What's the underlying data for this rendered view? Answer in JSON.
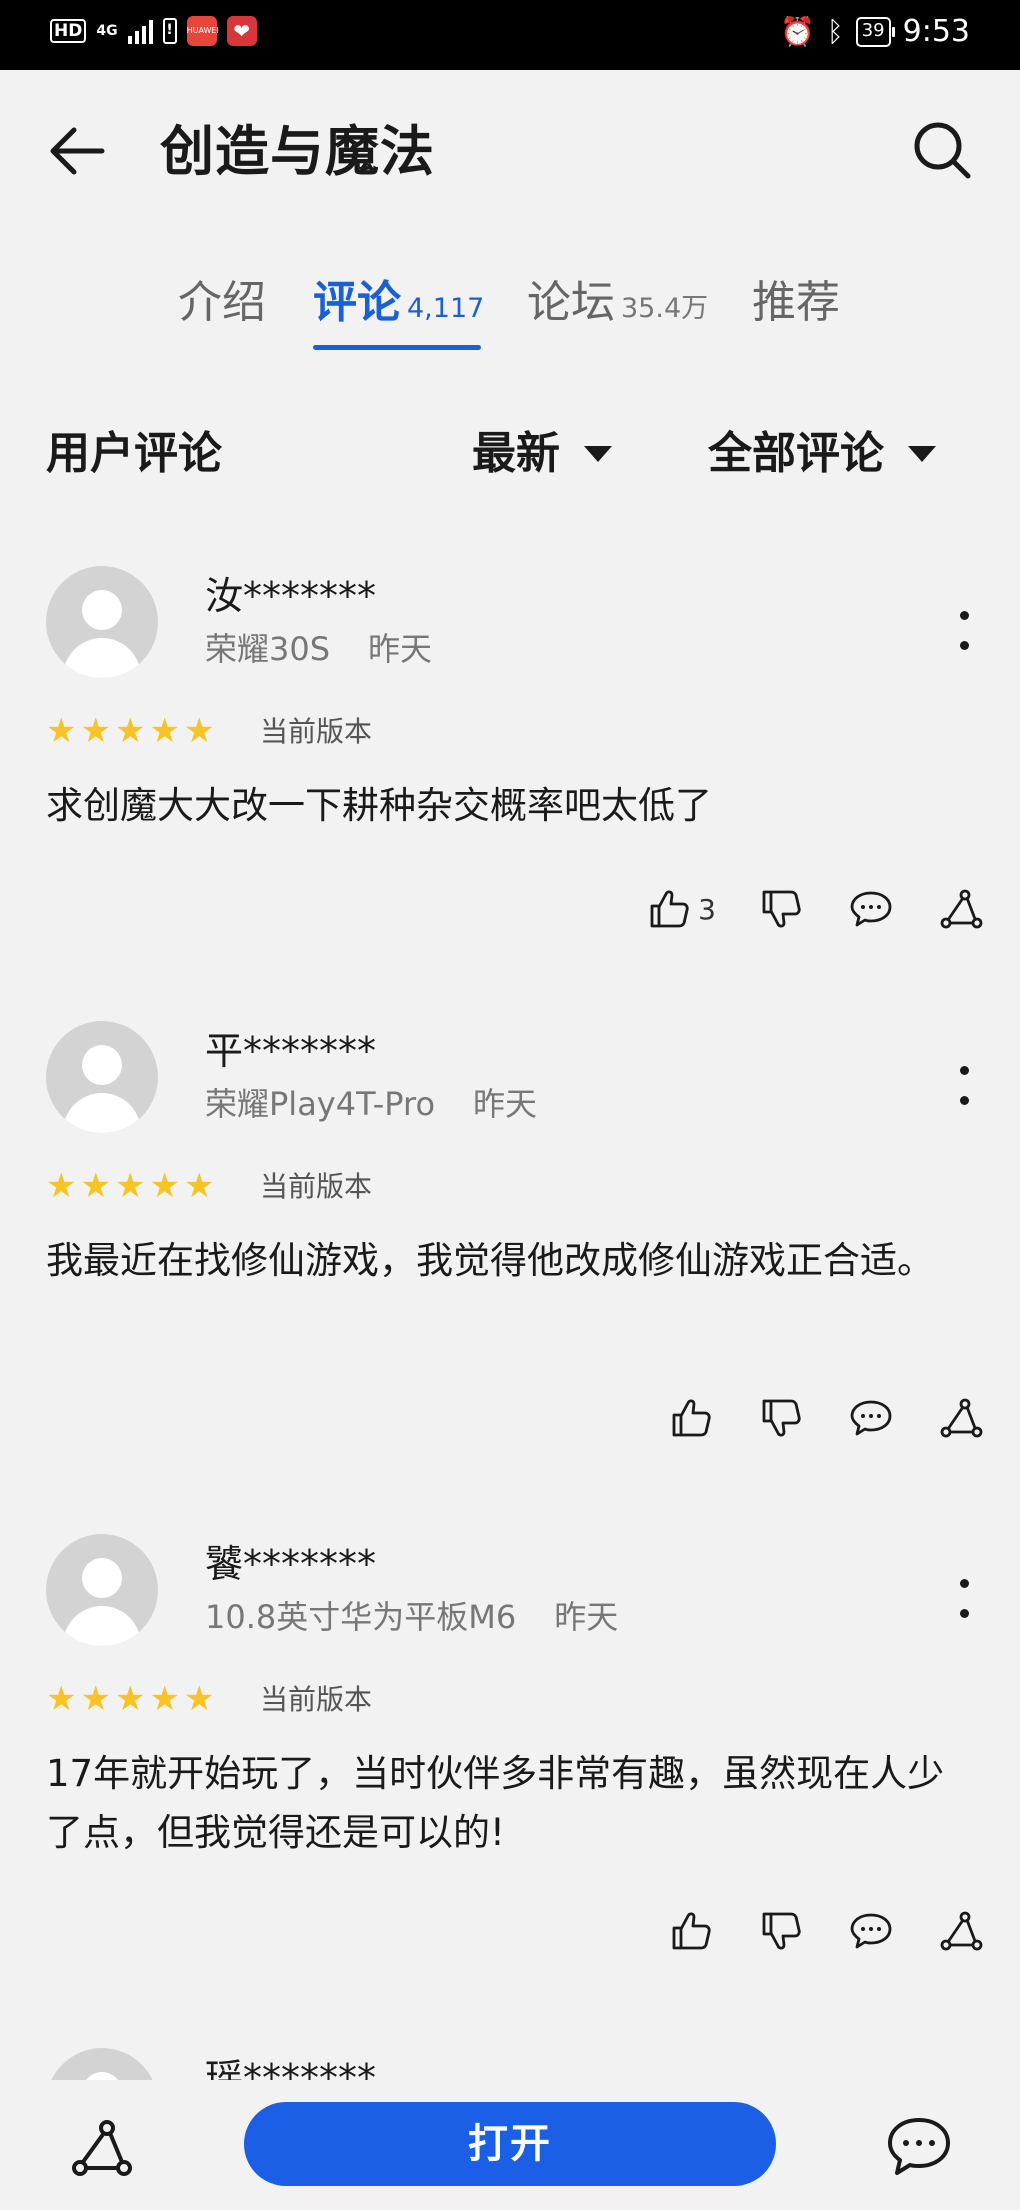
{
  "status_bar": {
    "hd": "HD",
    "network": "4G",
    "battery": "39",
    "time": "9:53"
  },
  "app": {
    "title": "创造与魔法"
  },
  "tabs": [
    {
      "label": "介绍",
      "count": ""
    },
    {
      "label": "评论",
      "count": "4,117"
    },
    {
      "label": "论坛",
      "count": "35.4万"
    },
    {
      "label": "推荐",
      "count": ""
    }
  ],
  "active_tab_index": 1,
  "filters": {
    "section_title": "用户评论",
    "sort": "最新",
    "scope": "全部评论"
  },
  "reviews": [
    {
      "user": "汝*******",
      "device": "荣耀30S",
      "date": "昨天",
      "rating": 5,
      "version": "当前版本",
      "text": "求创魔大大改一下耕种杂交概率吧太低了",
      "likes": "3"
    },
    {
      "user": "平*******",
      "device": "荣耀Play4T-Pro",
      "date": "昨天",
      "rating": 5,
      "version": "当前版本",
      "text": "我最近在找修仙游戏，我觉得他改成修仙游戏正合适。",
      "likes": ""
    },
    {
      "user": "饕*******",
      "device": "10.8英寸华为平板M6",
      "date": "昨天",
      "rating": 5,
      "version": "当前版本",
      "text": "17年就开始玩了，当时伙伴多非常有趣，虽然现在人少了点，但我觉得还是可以的!",
      "likes": ""
    },
    {
      "user": "瑶*******"
    }
  ],
  "bottom_bar": {
    "open_label": "打开"
  },
  "colors": {
    "accent": "#1a5fd6",
    "button": "#1a5fe6",
    "star": "#f7c325",
    "background": "#f2f2f2"
  }
}
